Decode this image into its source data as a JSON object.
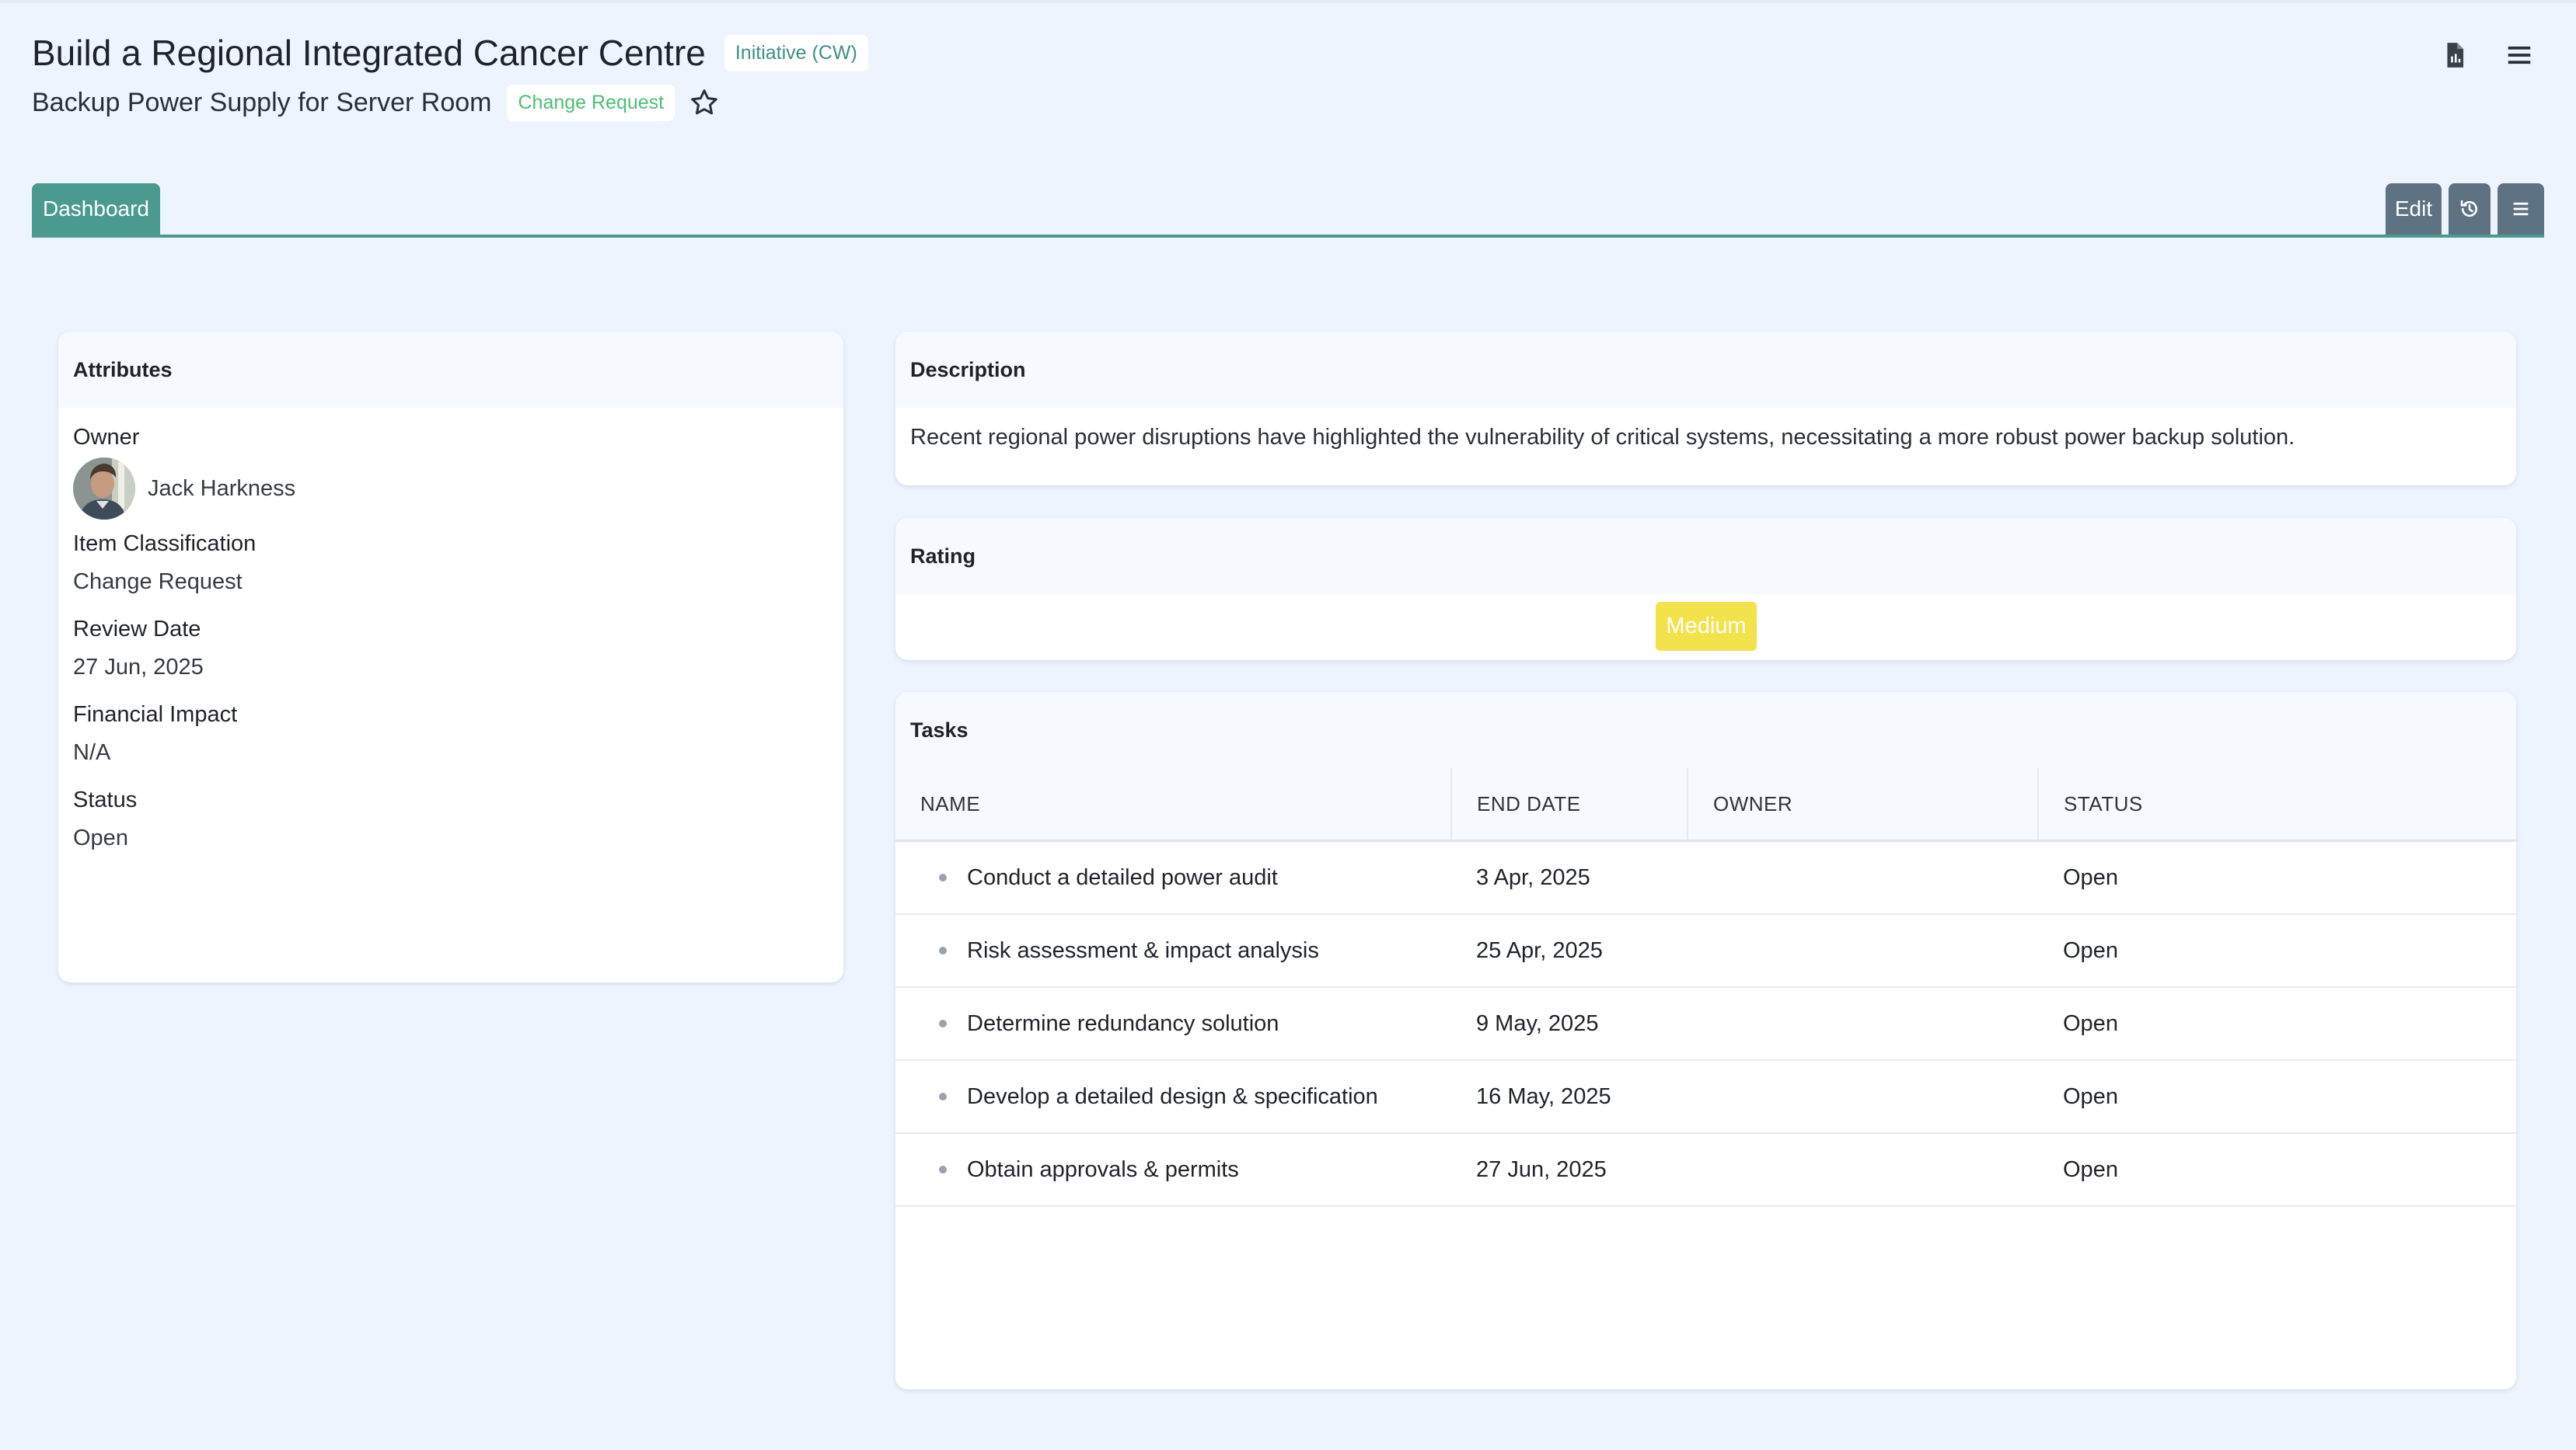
{
  "header": {
    "title": "Build a Regional Integrated Cancer Centre",
    "type_badge": "Initiative (CW)",
    "subtitle": "Backup Power Supply for Server Room",
    "class_badge": "Change Request",
    "icons": [
      "document-icon",
      "menu-icon",
      "star-icon"
    ]
  },
  "tabs": [
    {
      "label": "Dashboard",
      "active": true
    }
  ],
  "toolbar": {
    "edit_label": "Edit",
    "icons": [
      "history-icon",
      "menu-icon"
    ]
  },
  "attributes": {
    "title": "Attributes",
    "owner_label": "Owner",
    "owner_name": "Jack Harkness",
    "classification_label": "Item Classification",
    "classification_value": "Change Request",
    "review_date_label": "Review Date",
    "review_date_value": "27 Jun, 2025",
    "financial_label": "Financial Impact",
    "financial_value": "N/A",
    "status_label": "Status",
    "status_value": "Open"
  },
  "description": {
    "title": "Description",
    "text": "Recent regional power disruptions have highlighted the vulnerability of critical systems, necessitating a more robust power backup solution."
  },
  "rating": {
    "title": "Rating",
    "value": "Medium",
    "color": "#f2e24c"
  },
  "tasks": {
    "title": "Tasks",
    "columns": [
      "NAME",
      "END DATE",
      "OWNER",
      "STATUS"
    ],
    "rows": [
      {
        "name": "Conduct a detailed power audit",
        "end_date": "3 Apr, 2025",
        "owner": "",
        "status": "Open"
      },
      {
        "name": "Risk assessment & impact analysis",
        "end_date": "25 Apr, 2025",
        "owner": "",
        "status": "Open"
      },
      {
        "name": "Determine redundancy solution",
        "end_date": "9 May, 2025",
        "owner": "",
        "status": "Open"
      },
      {
        "name": "Develop a detailed design & specification",
        "end_date": "16 May, 2025",
        "owner": "",
        "status": "Open"
      },
      {
        "name": "Obtain approvals & permits",
        "end_date": "27 Jun, 2025",
        "owner": "",
        "status": "Open"
      }
    ]
  },
  "colors": {
    "accent": "#4a9a8f",
    "toolbar": "#5d7283",
    "background": "#eef4fd"
  }
}
